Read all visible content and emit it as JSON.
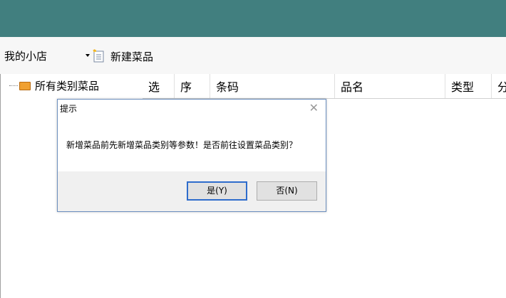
{
  "toolbar": {
    "shop_name": "我的小店",
    "new_dish_label": "新建菜品"
  },
  "tree": {
    "root_label": "所有类别菜品"
  },
  "grid": {
    "columns": [
      "选",
      "序",
      "条码",
      "品名",
      "类型",
      "分"
    ]
  },
  "dialog": {
    "title": "提示",
    "message": "新增菜品前先新增菜品类别等参数！是否前往设置菜品类别？",
    "yes_label": "是(Y)",
    "no_label": "否(N)"
  },
  "colors": {
    "titlebar": "#417f7f",
    "default_button_border": "#2e6ccc",
    "folder_icon": "#f0a030"
  }
}
